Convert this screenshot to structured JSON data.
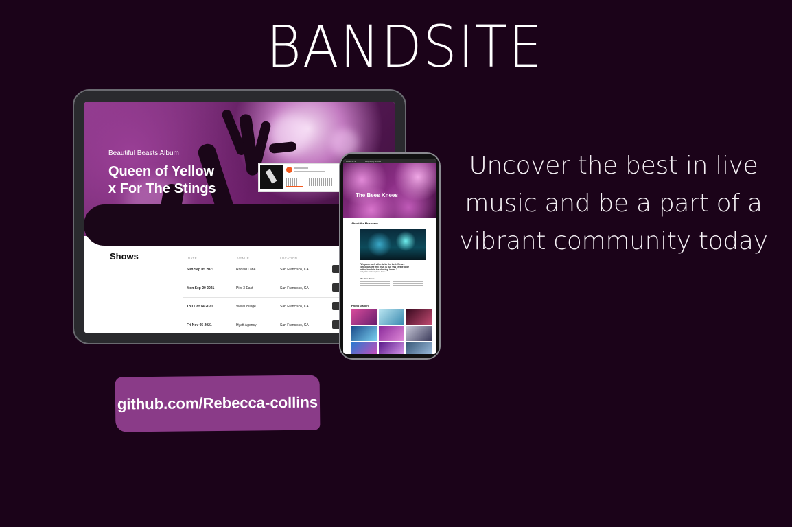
{
  "page": {
    "title": "BANDSITE",
    "tagline": "Uncover the best in live music and be a part of a vibrant community today",
    "github_link": "github.com/Rebecca-collins"
  },
  "tablet": {
    "hero": {
      "album_label": "Beautiful Beasts Album",
      "song_title_line1": "Queen of Yellow",
      "song_title_line2": "x For The Stings"
    },
    "shows": {
      "heading": "Shows",
      "columns": [
        "DATE",
        "VENUE",
        "LOCATION"
      ],
      "rows": [
        {
          "date": "Sun Sep 05 2021",
          "venue": "Ronald Lane",
          "location": "San Francisco, CA"
        },
        {
          "date": "Mon Sep 20 2021",
          "venue": "Pier 3 East",
          "location": "San Francisco, CA"
        },
        {
          "date": "Thu Oct 14 2021",
          "venue": "View Lounge",
          "location": "San Francisco, CA"
        },
        {
          "date": "Fri Nov 05 2021",
          "venue": "Hyatt Agency",
          "location": "San Francisco, CA"
        }
      ]
    }
  },
  "phone": {
    "nav": [
      "BANDSITE",
      "Biography",
      "Shows"
    ],
    "hero_title": "The Bees Knees",
    "about_heading": "About the Musicians",
    "quote": "\"We push each other to be the best. We are conscious the mix of us is our 'this create to be better, harsh in the shaking. board.\"",
    "quote_cite": "Cindy Aldo (Fictional) Band Name",
    "subheading": "The Bees Knees",
    "gallery_heading": "Photo Gallery"
  },
  "colors": {
    "background": "#1b0319",
    "badge": "#8a3b88",
    "hero_accent": "#8e3a8c",
    "player_accent": "#f45a1e"
  }
}
